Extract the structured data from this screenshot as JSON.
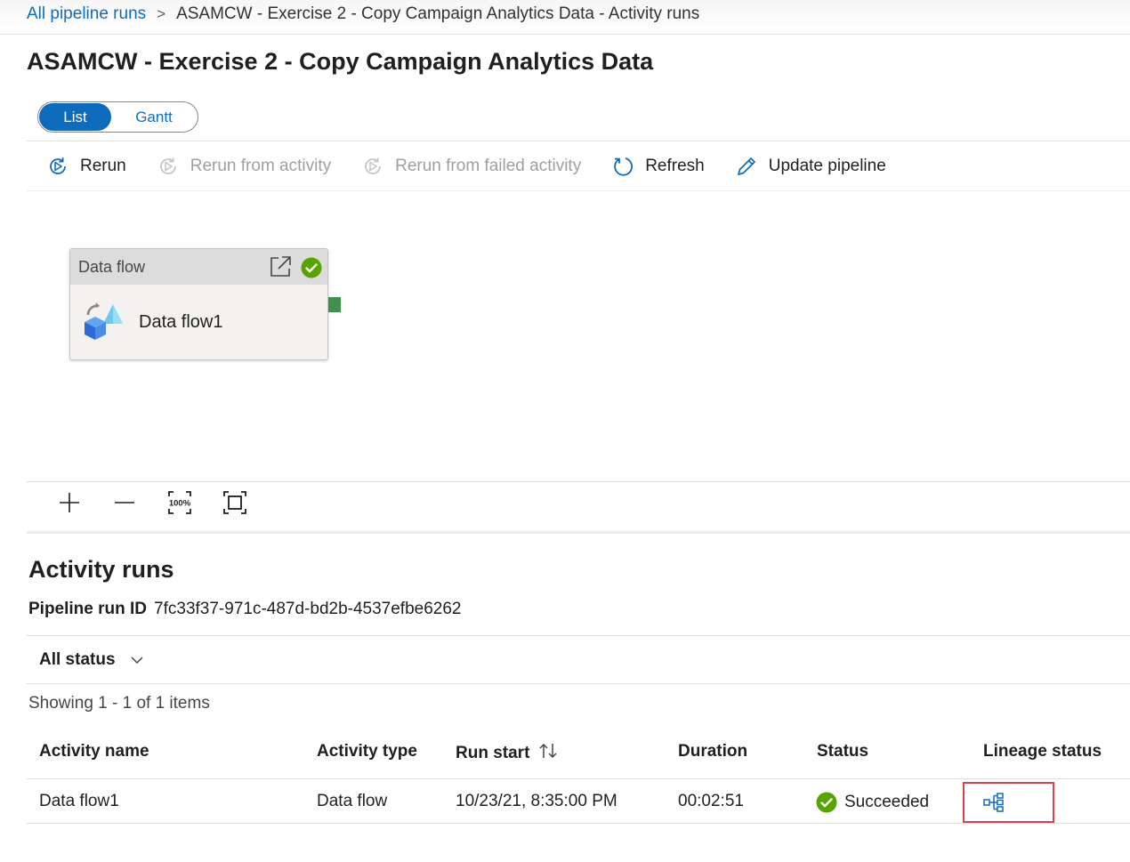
{
  "breadcrumb": {
    "parent": "All pipeline runs",
    "separator": ">",
    "current": "ASAMCW - Exercise 2 - Copy Campaign Analytics Data - Activity runs"
  },
  "page": {
    "title": "ASAMCW - Exercise 2 - Copy Campaign Analytics Data"
  },
  "view_toggle": {
    "options": [
      {
        "label": "List",
        "active": true
      },
      {
        "label": "Gantt",
        "active": false
      }
    ]
  },
  "toolbar": {
    "rerun": {
      "label": "Rerun",
      "icon": "rerun-icon",
      "enabled": true
    },
    "rerun_from_activity": {
      "label": "Rerun from activity",
      "icon": "rerun-icon",
      "enabled": false
    },
    "rerun_from_failed": {
      "label": "Rerun from failed activity",
      "icon": "rerun-icon",
      "enabled": false
    },
    "refresh": {
      "label": "Refresh",
      "icon": "refresh-icon",
      "enabled": true
    },
    "update_pipeline": {
      "label": "Update pipeline",
      "icon": "pencil-icon",
      "enabled": true
    }
  },
  "canvas": {
    "activity": {
      "type": "Data flow",
      "name": "Data flow1",
      "status": "succeeded",
      "icons": [
        "external-link-icon",
        "success-check-icon",
        "data-flow-icon"
      ]
    },
    "zoom_controls": [
      "zoom-in-icon",
      "zoom-out-icon",
      "zoom-100-icon",
      "fit-to-screen-icon"
    ],
    "zoom_100_label": "100%"
  },
  "activity_runs": {
    "title": "Activity runs",
    "run_id_label": "Pipeline run ID",
    "run_id_value": "7fc33f37-971c-487d-bd2b-4537efbe6262",
    "status_filter": "All status",
    "showing": "Showing 1 - 1 of 1 items",
    "columns": [
      "Activity name",
      "Activity type",
      "Run start",
      "Duration",
      "Status",
      "Lineage status"
    ],
    "rows": [
      {
        "activity_name": "Data flow1",
        "activity_type": "Data flow",
        "run_start": "10/23/21, 8:35:00 PM",
        "duration": "00:02:51",
        "status": "Succeeded",
        "lineage_icon": "lineage-icon"
      }
    ]
  },
  "colors": {
    "accent": "#0f6cbd",
    "success": "#57a300",
    "highlight_box": "#d9414e",
    "port": "#3f8f4f"
  }
}
